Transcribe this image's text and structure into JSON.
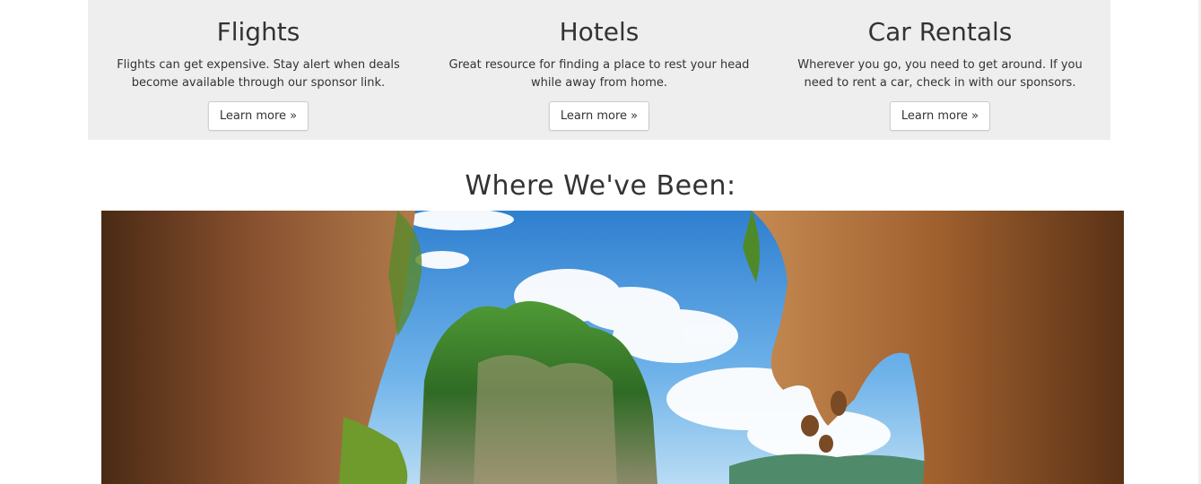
{
  "services": [
    {
      "title": "Flights",
      "description": "Flights can get expensive. Stay alert when deals become available through our sponsor link.",
      "button_label": "Learn more »"
    },
    {
      "title": "Hotels",
      "description": "Great resource for finding a place to rest your head while away from home.",
      "button_label": "Learn more »"
    },
    {
      "title": "Car Rentals",
      "description": "Wherever you go, you need to get around. If you need to rent a car, check in with our sponsors.",
      "button_label": "Learn more »"
    }
  ],
  "gallery": {
    "heading": "Where We've Been:",
    "photo_subject": "limestone-cave-arch-with-tropical-island"
  },
  "colors": {
    "panel_background": "#eeeeee",
    "text": "#333333",
    "button_border": "#cccccc",
    "sky": "#3f8fd6",
    "rock": "#9a5a2c",
    "foliage": "#3f7f2a"
  }
}
